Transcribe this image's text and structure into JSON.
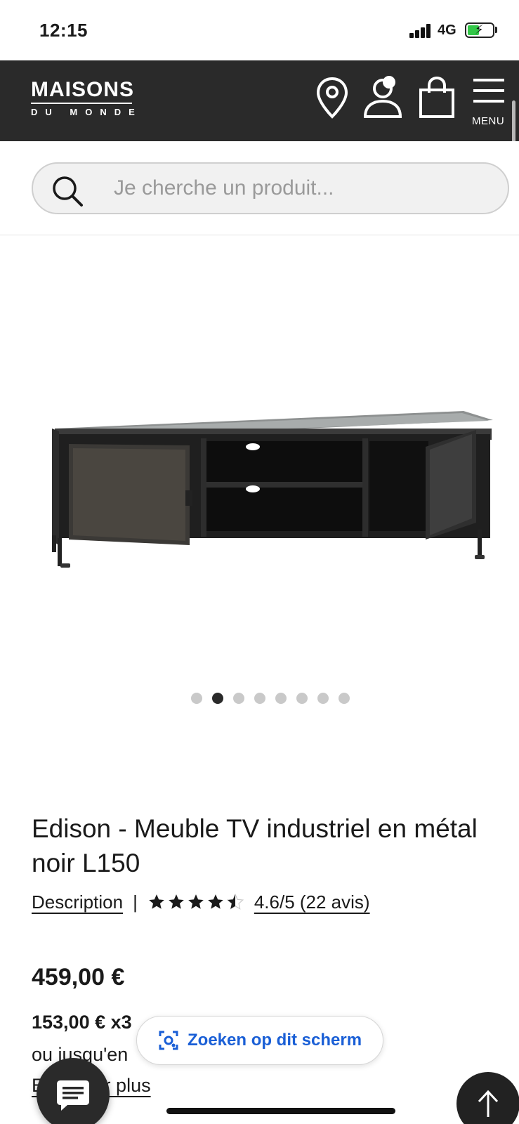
{
  "status_bar": {
    "time": "12:15",
    "network": "4G"
  },
  "header": {
    "logo_top": "MAISONS",
    "logo_bottom": "DU MONDE",
    "menu_label": "MENU",
    "background_color": "#2a2a2a"
  },
  "search": {
    "placeholder": "Je cherche un produit..."
  },
  "carousel": {
    "dots_total": 8,
    "active_index": 1
  },
  "product": {
    "title": "Edison - Meuble TV industriel en métal noir L150",
    "description_link": "Description",
    "separator": "|",
    "rating_value": 4.6,
    "rating_text": "4.6/5 (22 avis)",
    "price": "459,00 €",
    "installment": "153,00 € x3",
    "installment_sub": "ou jusqu'en",
    "more_link": "En savoir plus"
  },
  "lens_pill": {
    "label": "Zoeken op dit scherm",
    "accent_color": "#1a5fd6"
  },
  "icons": [
    "location-pin-icon",
    "account-icon",
    "shopping-bag-icon",
    "menu-icon",
    "search-icon",
    "lens-icon",
    "chat-icon",
    "arrow-up-icon"
  ]
}
